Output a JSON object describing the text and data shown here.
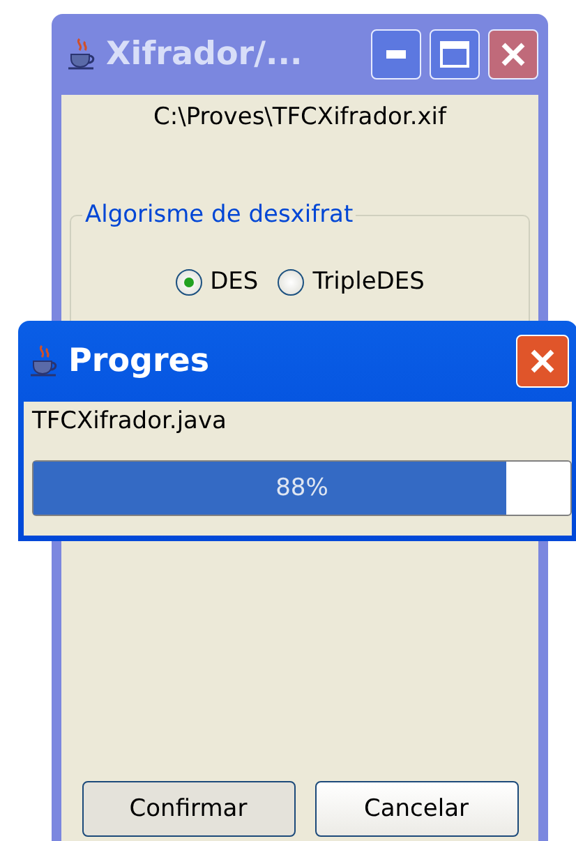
{
  "main_window": {
    "title": "Xifrador/...",
    "path": "C:\\Proves\\TFCXifrador.xif",
    "group": {
      "legend": "Algorisme de desxifrat",
      "options": [
        {
          "label": "DES",
          "selected": true
        },
        {
          "label": "TripleDES",
          "selected": false
        }
      ]
    },
    "buttons": [
      "Confirmar",
      "Cancelar"
    ]
  },
  "progress_dialog": {
    "title": "Progres",
    "file": "TFCXifrador.java",
    "progress": {
      "level": 0.88,
      "reading": "88%"
    }
  }
}
